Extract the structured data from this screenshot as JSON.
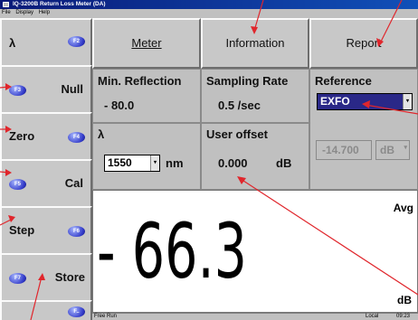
{
  "window": {
    "title": "IQ-3200B Return Loss Meter (DA)"
  },
  "menu": [
    "File",
    "Display",
    "Help"
  ],
  "sidebar": {
    "buttons": [
      {
        "label": "λ",
        "fkey": "F2"
      },
      {
        "label": "Null",
        "fkey": "F3"
      },
      {
        "label": "Zero",
        "fkey": "F4"
      },
      {
        "label": "Cal",
        "fkey": "F5"
      },
      {
        "label": "Step",
        "fkey": "F6"
      },
      {
        "label": "Store",
        "fkey": "F7"
      },
      {
        "label": "",
        "fkey": "F.."
      }
    ]
  },
  "tabs": {
    "meter": "Meter",
    "information": "Information",
    "report": "Report"
  },
  "min_reflection": {
    "label": "Min. Reflection",
    "value": "- 80.0"
  },
  "sampling_rate": {
    "label": "Sampling Rate",
    "value": "0.5 /sec"
  },
  "reference": {
    "label": "Reference",
    "selected": "EXFO",
    "value": "-14.700",
    "unit": "dB"
  },
  "wavelength": {
    "label": "λ",
    "value": "1550",
    "unit": "nm"
  },
  "user_offset": {
    "label": "User offset",
    "value": "0.000",
    "unit": "dB"
  },
  "display": {
    "reading": "- 66.3",
    "mode": "Avg",
    "unit": "dB"
  },
  "status": {
    "mode": "Free Run",
    "control": "Local",
    "time": "09:23"
  },
  "colors": {
    "callout": "#e0262c",
    "selection": "#2a2888",
    "fkey": "#3038c8"
  }
}
